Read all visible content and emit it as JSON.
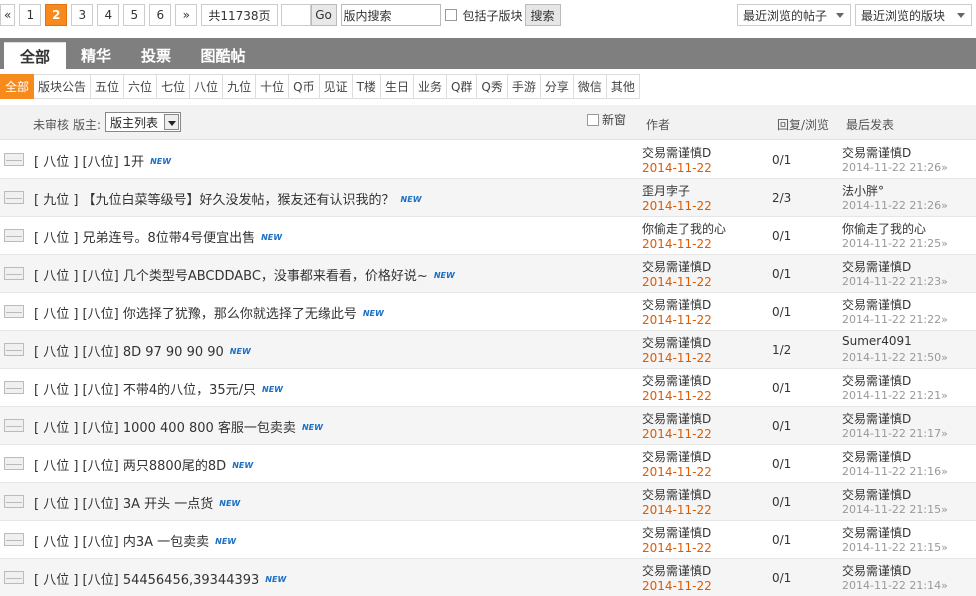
{
  "pager": {
    "first": "«",
    "pages": [
      "1",
      "2",
      "3",
      "4",
      "5",
      "6"
    ],
    "current": "2",
    "next": "»",
    "total": "共11738页",
    "go": "Go",
    "search_value": "版内搜索",
    "include_sub": "包括子版块",
    "search_btn": "搜索"
  },
  "recent": {
    "posts": "最近浏览的帖子",
    "boards": "最近浏览的版块"
  },
  "tabs": [
    "全部",
    "精华",
    "投票",
    "图酷帖"
  ],
  "categories": [
    "全部",
    "版块公告",
    "五位",
    "六位",
    "七位",
    "八位",
    "九位",
    "十位",
    "Q币",
    "见证",
    "T楼",
    "生日",
    "业务",
    "Q群",
    "Q秀",
    "手游",
    "分享",
    "微信",
    "其他"
  ],
  "header": {
    "unreviewed": "未审核",
    "moderator_label": "版主:",
    "moderator_select": "版主列表",
    "new_window": "新窗",
    "author": "作者",
    "reply_view": "回复/浏览",
    "last_post": "最后发表"
  },
  "new_badge": "NEW",
  "threads": [
    {
      "title": "[ 八位 ] [八位] 1开",
      "author": "交易需谨慎D",
      "date": "2014-11-22",
      "stat": "0/1",
      "last_user": "交易需谨慎D",
      "last_time": "2014-11-22 21:26»"
    },
    {
      "title": "[ 九位 ] 【九位白菜等级号】好久没发帖，猴友还有认识我的？",
      "author": "歪月孛子",
      "date": "2014-11-22",
      "stat": "2/3",
      "last_user": "法小胖°",
      "last_time": "2014-11-22 21:26»"
    },
    {
      "title": "[ 八位 ] 兄弟连号。8位带4号便宜出售",
      "author": "你偷走了我的心",
      "date": "2014-11-22",
      "stat": "0/1",
      "last_user": "你偷走了我的心",
      "last_time": "2014-11-22 21:25»"
    },
    {
      "title": "[ 八位 ] [八位] 几个类型号ABCDDABC，没事都来看看，价格好说~",
      "author": "交易需谨慎D",
      "date": "2014-11-22",
      "stat": "0/1",
      "last_user": "交易需谨慎D",
      "last_time": "2014-11-22 21:23»"
    },
    {
      "title": "[ 八位 ] [八位] 你选择了犹豫，那么你就选择了无缘此号",
      "author": "交易需谨慎D",
      "date": "2014-11-22",
      "stat": "0/1",
      "last_user": "交易需谨慎D",
      "last_time": "2014-11-22 21:22»"
    },
    {
      "title": "[ 八位 ] [八位] 8D 97 90 90 90",
      "author": "交易需谨慎D",
      "date": "2014-11-22",
      "stat": "1/2",
      "last_user": "Sumer4091",
      "last_time": "2014-11-22 21:50»"
    },
    {
      "title": "[ 八位 ] [八位] 不带4的八位，35元/只",
      "author": "交易需谨慎D",
      "date": "2014-11-22",
      "stat": "0/1",
      "last_user": "交易需谨慎D",
      "last_time": "2014-11-22 21:21»"
    },
    {
      "title": "[ 八位 ] [八位] 1000 400 800 客服一包卖卖",
      "author": "交易需谨慎D",
      "date": "2014-11-22",
      "stat": "0/1",
      "last_user": "交易需谨慎D",
      "last_time": "2014-11-22 21:17»"
    },
    {
      "title": "[ 八位 ] [八位] 两只8800尾的8D",
      "author": "交易需谨慎D",
      "date": "2014-11-22",
      "stat": "0/1",
      "last_user": "交易需谨慎D",
      "last_time": "2014-11-22 21:16»"
    },
    {
      "title": "[ 八位 ] [八位] 3A 开头 一点货",
      "author": "交易需谨慎D",
      "date": "2014-11-22",
      "stat": "0/1",
      "last_user": "交易需谨慎D",
      "last_time": "2014-11-22 21:15»"
    },
    {
      "title": "[ 八位 ] [八位] 内3A 一包卖卖",
      "author": "交易需谨慎D",
      "date": "2014-11-22",
      "stat": "0/1",
      "last_user": "交易需谨慎D",
      "last_time": "2014-11-22 21:15»"
    },
    {
      "title": "[ 八位 ] [八位] 54456456,39344393",
      "author": "交易需谨慎D",
      "date": "2014-11-22",
      "stat": "0/1",
      "last_user": "交易需谨慎D",
      "last_time": "2014-11-22 21:14»"
    }
  ]
}
